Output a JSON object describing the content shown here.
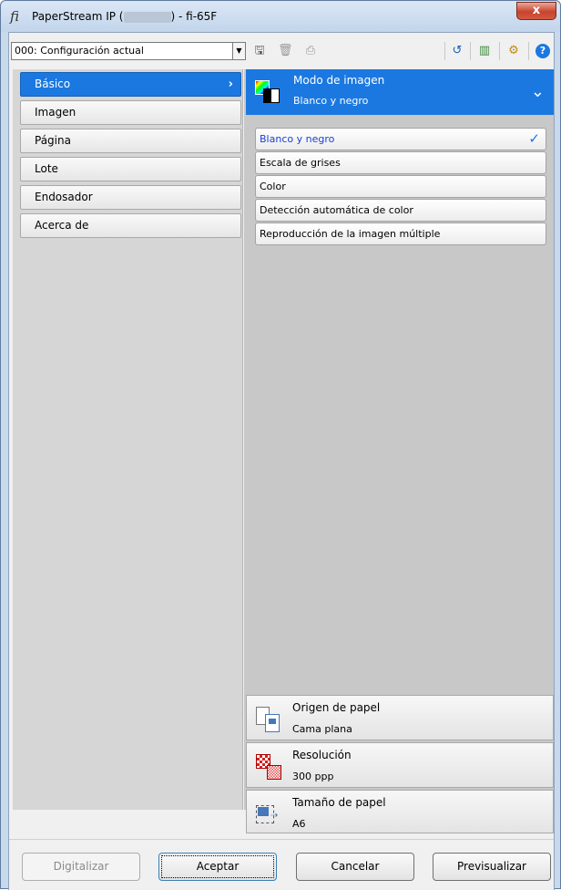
{
  "window": {
    "app_logo": "fi",
    "title_prefix": "PaperStream IP (",
    "title_suffix": ") - fi-65F",
    "close_label": "x"
  },
  "toolbar": {
    "profile_value": "000: Configuración actual",
    "icons": [
      "save-icon",
      "delete-icon",
      "preview-icon",
      "undo-icon",
      "reset-icon",
      "settings-icon",
      "help-icon"
    ]
  },
  "nav": {
    "items": [
      {
        "label": "Básico"
      },
      {
        "label": "Imagen"
      },
      {
        "label": "Página"
      },
      {
        "label": "Lote"
      },
      {
        "label": "Endosador"
      },
      {
        "label": "Acerca de"
      }
    ],
    "active_index": 0
  },
  "image_mode": {
    "title": "Modo de imagen",
    "value": "Blanco y negro",
    "options": [
      {
        "label": "Blanco y negro",
        "selected": true
      },
      {
        "label": "Escala de grises"
      },
      {
        "label": "Color"
      },
      {
        "label": "Detección automática de color"
      },
      {
        "label": "Reproducción de la imagen múltiple"
      }
    ]
  },
  "sections": {
    "paper_source": {
      "title": "Origen de papel",
      "value": "Cama plana"
    },
    "resolution": {
      "title": "Resolución",
      "value": "300 ppp"
    },
    "paper_size": {
      "title": "Tamaño de papel",
      "value": "A6"
    }
  },
  "buttons": {
    "scan": "Digitalizar",
    "ok": "Aceptar",
    "cancel": "Cancelar",
    "preview": "Previsualizar"
  },
  "colors": {
    "accent": "#1b78e0",
    "selected_text": "#1a3fd1"
  }
}
